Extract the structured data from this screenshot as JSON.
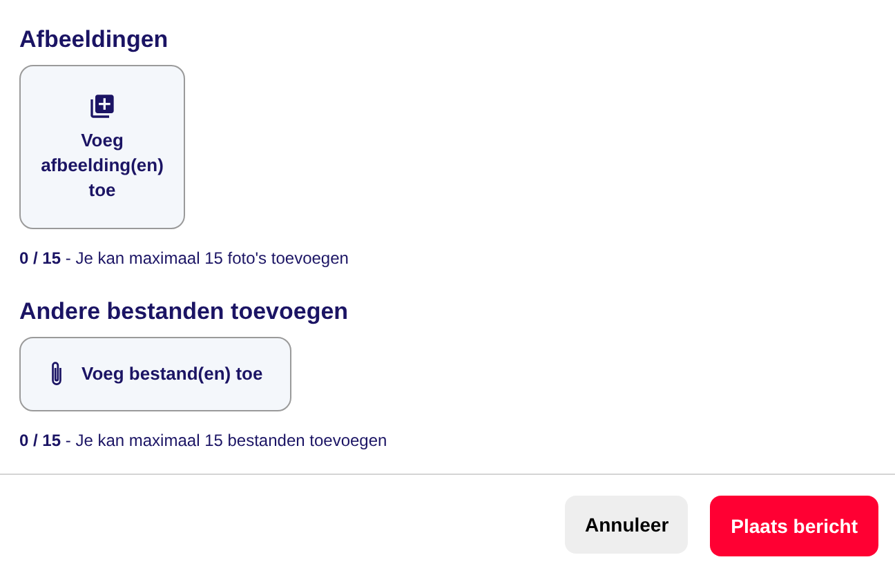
{
  "sections": [
    {
      "kind": "images",
      "title": "Afbeeldingen",
      "button": "Voeg afbeelding(en) toe",
      "note": "**0 / 15** - Je kan maximaal 15 foto's toevoegen"
    },
    {
      "kind": "files",
      "title": "Andere bestanden toevoegen",
      "button": "Voeg bestand(en) toe",
      "note": "**0 / 15** - Je kan maximaal 15 bestanden toevoegen"
    }
  ],
  "footer": {
    "cancel": "Annuleer",
    "submit": "Plaats bericht"
  }
}
